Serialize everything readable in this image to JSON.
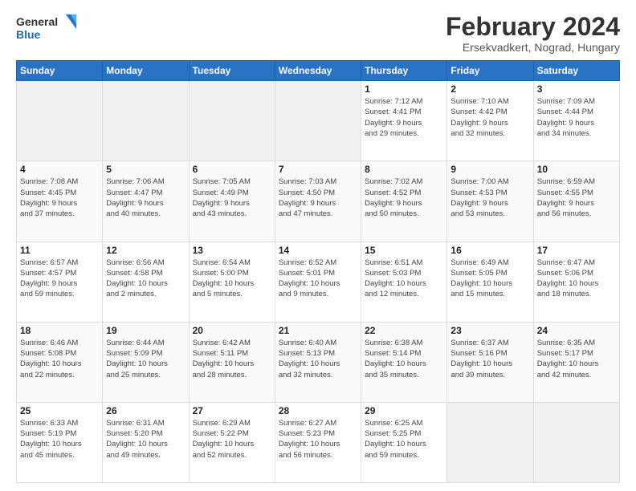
{
  "logo": {
    "line1": "General",
    "line2": "Blue"
  },
  "header": {
    "title": "February 2024",
    "subtitle": "Ersekvadkert, Nograd, Hungary"
  },
  "columns": [
    "Sunday",
    "Monday",
    "Tuesday",
    "Wednesday",
    "Thursday",
    "Friday",
    "Saturday"
  ],
  "weeks": [
    [
      {
        "day": "",
        "info": ""
      },
      {
        "day": "",
        "info": ""
      },
      {
        "day": "",
        "info": ""
      },
      {
        "day": "",
        "info": ""
      },
      {
        "day": "1",
        "info": "Sunrise: 7:12 AM\nSunset: 4:41 PM\nDaylight: 9 hours\nand 29 minutes."
      },
      {
        "day": "2",
        "info": "Sunrise: 7:10 AM\nSunset: 4:42 PM\nDaylight: 9 hours\nand 32 minutes."
      },
      {
        "day": "3",
        "info": "Sunrise: 7:09 AM\nSunset: 4:44 PM\nDaylight: 9 hours\nand 34 minutes."
      }
    ],
    [
      {
        "day": "4",
        "info": "Sunrise: 7:08 AM\nSunset: 4:45 PM\nDaylight: 9 hours\nand 37 minutes."
      },
      {
        "day": "5",
        "info": "Sunrise: 7:06 AM\nSunset: 4:47 PM\nDaylight: 9 hours\nand 40 minutes."
      },
      {
        "day": "6",
        "info": "Sunrise: 7:05 AM\nSunset: 4:49 PM\nDaylight: 9 hours\nand 43 minutes."
      },
      {
        "day": "7",
        "info": "Sunrise: 7:03 AM\nSunset: 4:50 PM\nDaylight: 9 hours\nand 47 minutes."
      },
      {
        "day": "8",
        "info": "Sunrise: 7:02 AM\nSunset: 4:52 PM\nDaylight: 9 hours\nand 50 minutes."
      },
      {
        "day": "9",
        "info": "Sunrise: 7:00 AM\nSunset: 4:53 PM\nDaylight: 9 hours\nand 53 minutes."
      },
      {
        "day": "10",
        "info": "Sunrise: 6:59 AM\nSunset: 4:55 PM\nDaylight: 9 hours\nand 56 minutes."
      }
    ],
    [
      {
        "day": "11",
        "info": "Sunrise: 6:57 AM\nSunset: 4:57 PM\nDaylight: 9 hours\nand 59 minutes."
      },
      {
        "day": "12",
        "info": "Sunrise: 6:56 AM\nSunset: 4:58 PM\nDaylight: 10 hours\nand 2 minutes."
      },
      {
        "day": "13",
        "info": "Sunrise: 6:54 AM\nSunset: 5:00 PM\nDaylight: 10 hours\nand 5 minutes."
      },
      {
        "day": "14",
        "info": "Sunrise: 6:52 AM\nSunset: 5:01 PM\nDaylight: 10 hours\nand 9 minutes."
      },
      {
        "day": "15",
        "info": "Sunrise: 6:51 AM\nSunset: 5:03 PM\nDaylight: 10 hours\nand 12 minutes."
      },
      {
        "day": "16",
        "info": "Sunrise: 6:49 AM\nSunset: 5:05 PM\nDaylight: 10 hours\nand 15 minutes."
      },
      {
        "day": "17",
        "info": "Sunrise: 6:47 AM\nSunset: 5:06 PM\nDaylight: 10 hours\nand 18 minutes."
      }
    ],
    [
      {
        "day": "18",
        "info": "Sunrise: 6:46 AM\nSunset: 5:08 PM\nDaylight: 10 hours\nand 22 minutes."
      },
      {
        "day": "19",
        "info": "Sunrise: 6:44 AM\nSunset: 5:09 PM\nDaylight: 10 hours\nand 25 minutes."
      },
      {
        "day": "20",
        "info": "Sunrise: 6:42 AM\nSunset: 5:11 PM\nDaylight: 10 hours\nand 28 minutes."
      },
      {
        "day": "21",
        "info": "Sunrise: 6:40 AM\nSunset: 5:13 PM\nDaylight: 10 hours\nand 32 minutes."
      },
      {
        "day": "22",
        "info": "Sunrise: 6:38 AM\nSunset: 5:14 PM\nDaylight: 10 hours\nand 35 minutes."
      },
      {
        "day": "23",
        "info": "Sunrise: 6:37 AM\nSunset: 5:16 PM\nDaylight: 10 hours\nand 39 minutes."
      },
      {
        "day": "24",
        "info": "Sunrise: 6:35 AM\nSunset: 5:17 PM\nDaylight: 10 hours\nand 42 minutes."
      }
    ],
    [
      {
        "day": "25",
        "info": "Sunrise: 6:33 AM\nSunset: 5:19 PM\nDaylight: 10 hours\nand 45 minutes."
      },
      {
        "day": "26",
        "info": "Sunrise: 6:31 AM\nSunset: 5:20 PM\nDaylight: 10 hours\nand 49 minutes."
      },
      {
        "day": "27",
        "info": "Sunrise: 6:29 AM\nSunset: 5:22 PM\nDaylight: 10 hours\nand 52 minutes."
      },
      {
        "day": "28",
        "info": "Sunrise: 6:27 AM\nSunset: 5:23 PM\nDaylight: 10 hours\nand 56 minutes."
      },
      {
        "day": "29",
        "info": "Sunrise: 6:25 AM\nSunset: 5:25 PM\nDaylight: 10 hours\nand 59 minutes."
      },
      {
        "day": "",
        "info": ""
      },
      {
        "day": "",
        "info": ""
      }
    ]
  ]
}
